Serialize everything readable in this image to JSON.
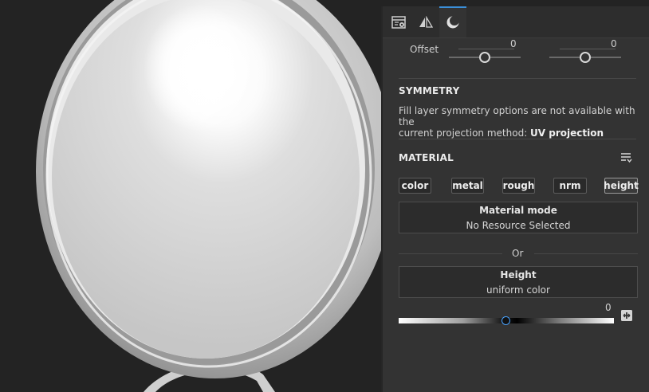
{
  "tabs": [
    {
      "icon": "layer-settings-icon"
    },
    {
      "icon": "symmetry-icon"
    },
    {
      "icon": "material-sphere-icon",
      "active": true
    }
  ],
  "offset": {
    "label": "Offset",
    "values": [
      "0",
      "0"
    ],
    "levels": [
      0.5,
      0.5
    ]
  },
  "symmetry": {
    "title": "SYMMETRY",
    "text_line1": "Fill layer symmetry options are not available with the",
    "text_line2_prefix": "current projection method: ",
    "text_line2_bold": "UV projection"
  },
  "material": {
    "title": "MATERIAL",
    "menu_icon": "list-options-icon",
    "channels": [
      "color",
      "metal",
      "rough",
      "nrm",
      "height"
    ],
    "active_channel": "height",
    "mode_title": "Material mode",
    "mode_value": "No Resource Selected",
    "or_label": "Or",
    "height_title": "Height",
    "height_value": "uniform color",
    "height_number": "0",
    "height_level": 0.5,
    "picker_icon": "color-picker-icon"
  },
  "colors": {
    "accent": "#3b8fd8",
    "panel": "#333333",
    "viewport": "#232323"
  }
}
